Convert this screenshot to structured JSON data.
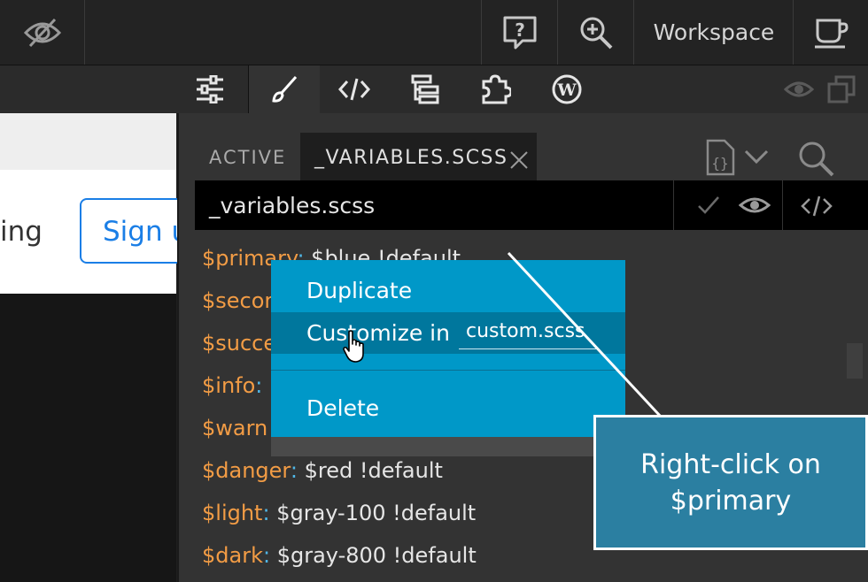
{
  "topbar": {
    "workspace_label": "Workspace",
    "icons": [
      "eye-slash-icon",
      "help-icon",
      "zoom-in-icon",
      "coffee-cup-icon"
    ]
  },
  "toolbar": {
    "icons": [
      "sliders-icon",
      "brush-icon",
      "code-icon",
      "tree-icon",
      "puzzle-icon",
      "wordpress-icon",
      "eye-icon",
      "copy-icon"
    ]
  },
  "preview": {
    "text_fragment": "ing",
    "signup_label": "Sign u"
  },
  "editor": {
    "tab_active_label": "ACTIVE",
    "tab_file_label": "_VARIABLES.SCSS",
    "file_name": "_variables.scss",
    "lines": [
      {
        "var": "$primary",
        "value": " $blue !default"
      },
      {
        "var": "$secor",
        "value": ""
      },
      {
        "var": "$succe",
        "value": ""
      },
      {
        "var": "$info",
        "value": ""
      },
      {
        "var": "$warn",
        "value": ""
      },
      {
        "var": "$danger",
        "value": " $red !default"
      },
      {
        "var": "$light",
        "value": " $gray-100 !default"
      },
      {
        "var": "$dark",
        "value": " $gray-800 !default"
      }
    ]
  },
  "context_menu": {
    "items": [
      "Duplicate",
      "Customize in",
      "Delete"
    ],
    "customize_target": "custom.scss"
  },
  "callout": {
    "line1": "Right-click on",
    "line2": "$primary"
  },
  "colors": {
    "menu_bg": "#0098c8",
    "menu_highlight": "#00779d",
    "callout_bg": "#2b7fa1",
    "variable": "#f29c45",
    "link_blue": "#1a7ee6"
  }
}
